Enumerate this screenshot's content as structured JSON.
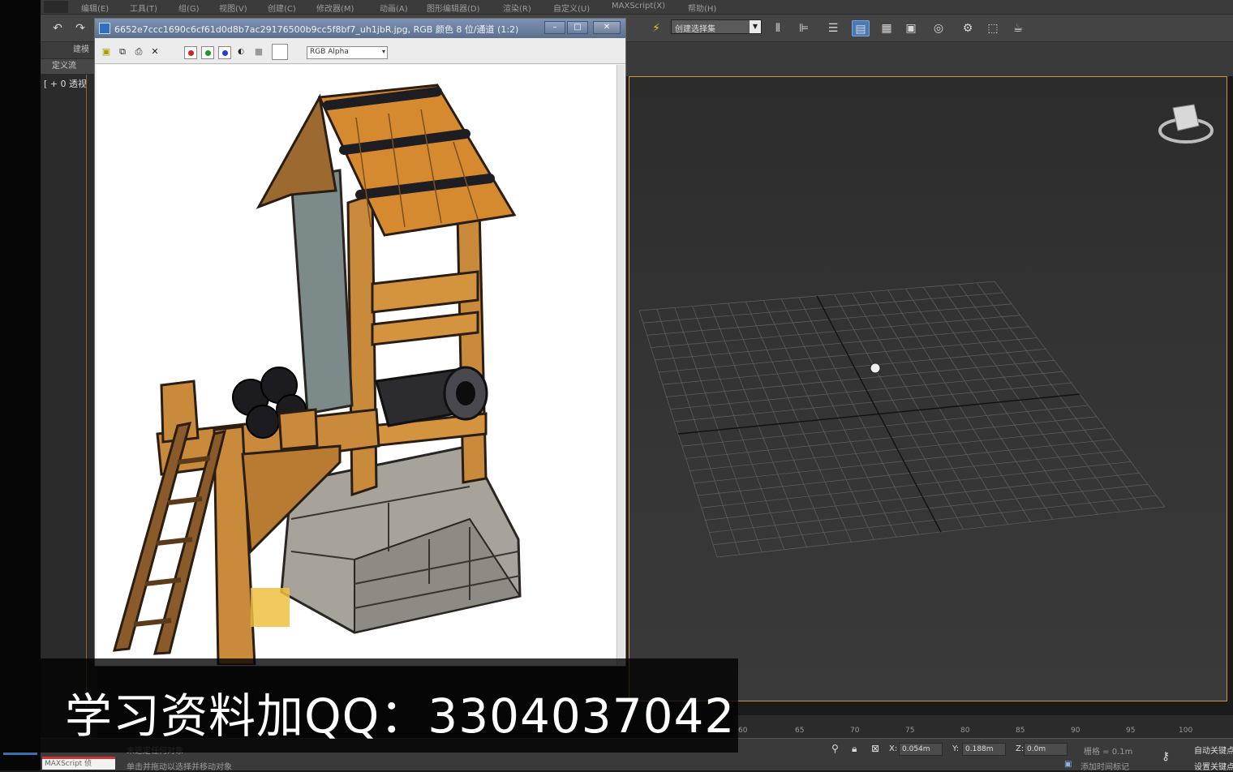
{
  "menu": {
    "items": [
      "编辑(E)",
      "工具(T)",
      "组(G)",
      "视图(V)",
      "创建(C)",
      "修改器(M)",
      "动画(A)",
      "图形编辑器(D)",
      "渲染(R)",
      "自定义(U)",
      "MAXScript(X)",
      "帮助(H)"
    ]
  },
  "toolbar": {
    "selection_set": "创建选择集"
  },
  "command_panel": {
    "row1_label": "建模",
    "row2_label": "定义流",
    "viewport_label": "[ + 0 透视"
  },
  "image_viewer": {
    "title": "6652e7ccc1690c6cf61d0d8b7ac29176500b9cc5f8bf7_uh1jbR.jpg, RGB 颜色 8 位/通道 (1:2)",
    "minimize": "–",
    "maximize": "□",
    "close": "✕",
    "channel": "RGB Alpha",
    "colors": {
      "red": "#d42020",
      "green": "#1a9a2a",
      "blue": "#1f3fd8"
    }
  },
  "timeline": {
    "ticks": [
      "60",
      "65",
      "70",
      "75",
      "80",
      "85",
      "90",
      "95",
      "100"
    ]
  },
  "status": {
    "maxscript": "MAXScript 侦",
    "prompt1": "未选定任何对象",
    "prompt2": "单击并拖动以选择并移动对象",
    "x_label": "X:",
    "x_value": "0.054m",
    "y_label": "Y:",
    "y_value": "0.188m",
    "z_label": "Z:",
    "z_value": "0.0m",
    "grid": "栅格 = 0.1m",
    "auto_key": "自动关键点",
    "set_key": "设置关键点",
    "add_time_tag": "添加时间标记"
  },
  "overlay": {
    "text": "学习资料加QQ：3304037042"
  }
}
